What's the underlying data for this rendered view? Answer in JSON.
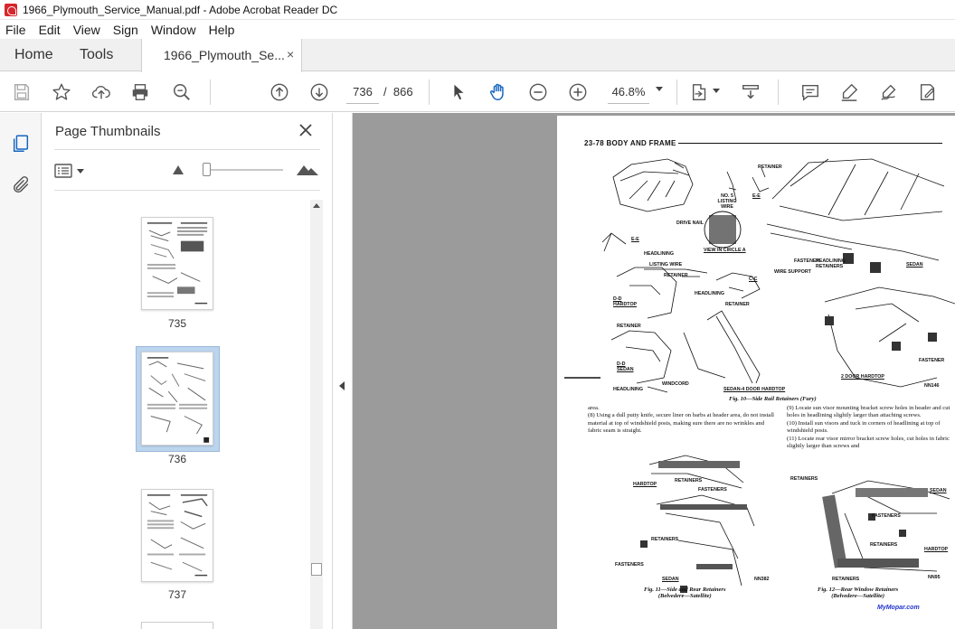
{
  "window": {
    "title": "1966_Plymouth_Service_Manual.pdf - Adobe Acrobat Reader DC"
  },
  "menu": [
    "File",
    "Edit",
    "View",
    "Sign",
    "Window",
    "Help"
  ],
  "tabs": {
    "home": "Home",
    "tools": "Tools",
    "document": "1966_Plymouth_Se...",
    "close_symbol": "×"
  },
  "toolbar": {
    "current_page": "736",
    "page_separator": "/",
    "total_pages": "866",
    "zoom": "46.8%"
  },
  "thumbnails": {
    "title": "Page Thumbnails",
    "pages": [
      "735",
      "736",
      "737"
    ],
    "selected": "736"
  },
  "page": {
    "header": "23-78   BODY AND FRAME",
    "fig10": "Fig. 10—Side Rail Retainers (Fury)",
    "fig11_line1": "Fig. 11—Side and Rear Retainers",
    "fig11_line2": "(Belvedere—Satellite)",
    "fig12_line1": "Fig. 12—Rear Window Retainers",
    "fig12_line2": "(Belvedere—Satellite)",
    "text_left": "area.\n(8) Using a dull putty knife, secure liner on barbs at header area, do not install material at top of windshield posts, making sure there are no wrinkles and fabric seam is straight.",
    "text_right": "(9) Locate sun visor mounting bracket screw holes in header and cut holes in headlining slightly larger than attaching screws.\n(10) Install sun visors and tuck in corners of headlining at top of windshield posts.\n(11) Locate rear visor mirror bracket screw holes, cut holes in fabric slightly larger than screws and",
    "watermark": "MyMopar.com",
    "labels": {
      "retainer": "RETAINER",
      "listing_wire": "NO. 5 LISTING WIRE",
      "drive_nail": "DRIVE NAIL",
      "view_circle": "VIEW IN CIRCLE A",
      "ee": "E-E",
      "headlining": "HEADLINING",
      "fastener": "FASTENER",
      "headlining_retainers": "HEADLINING RETAINERS",
      "sedan": "SEDAN",
      "listing_wire2": "LISTING WIRE",
      "wire_support": "WIRE SUPPORT",
      "dd_hardtop": "D-D HARDTOP",
      "cc": "C-C",
      "dd_sedan": "D-D SEDAN",
      "windcord": "WINDCORD",
      "sedan_4door": "SEDAN-4 DOOR HARDTOP",
      "hardtop_2door": "2 DOOR HARDTOP",
      "nn146": "NN146",
      "hardtop": "HARDTOP",
      "retainers": "RETAINERS",
      "fasteners": "FASTENERS",
      "nn382": "NN382",
      "nn95": "NN95"
    }
  }
}
